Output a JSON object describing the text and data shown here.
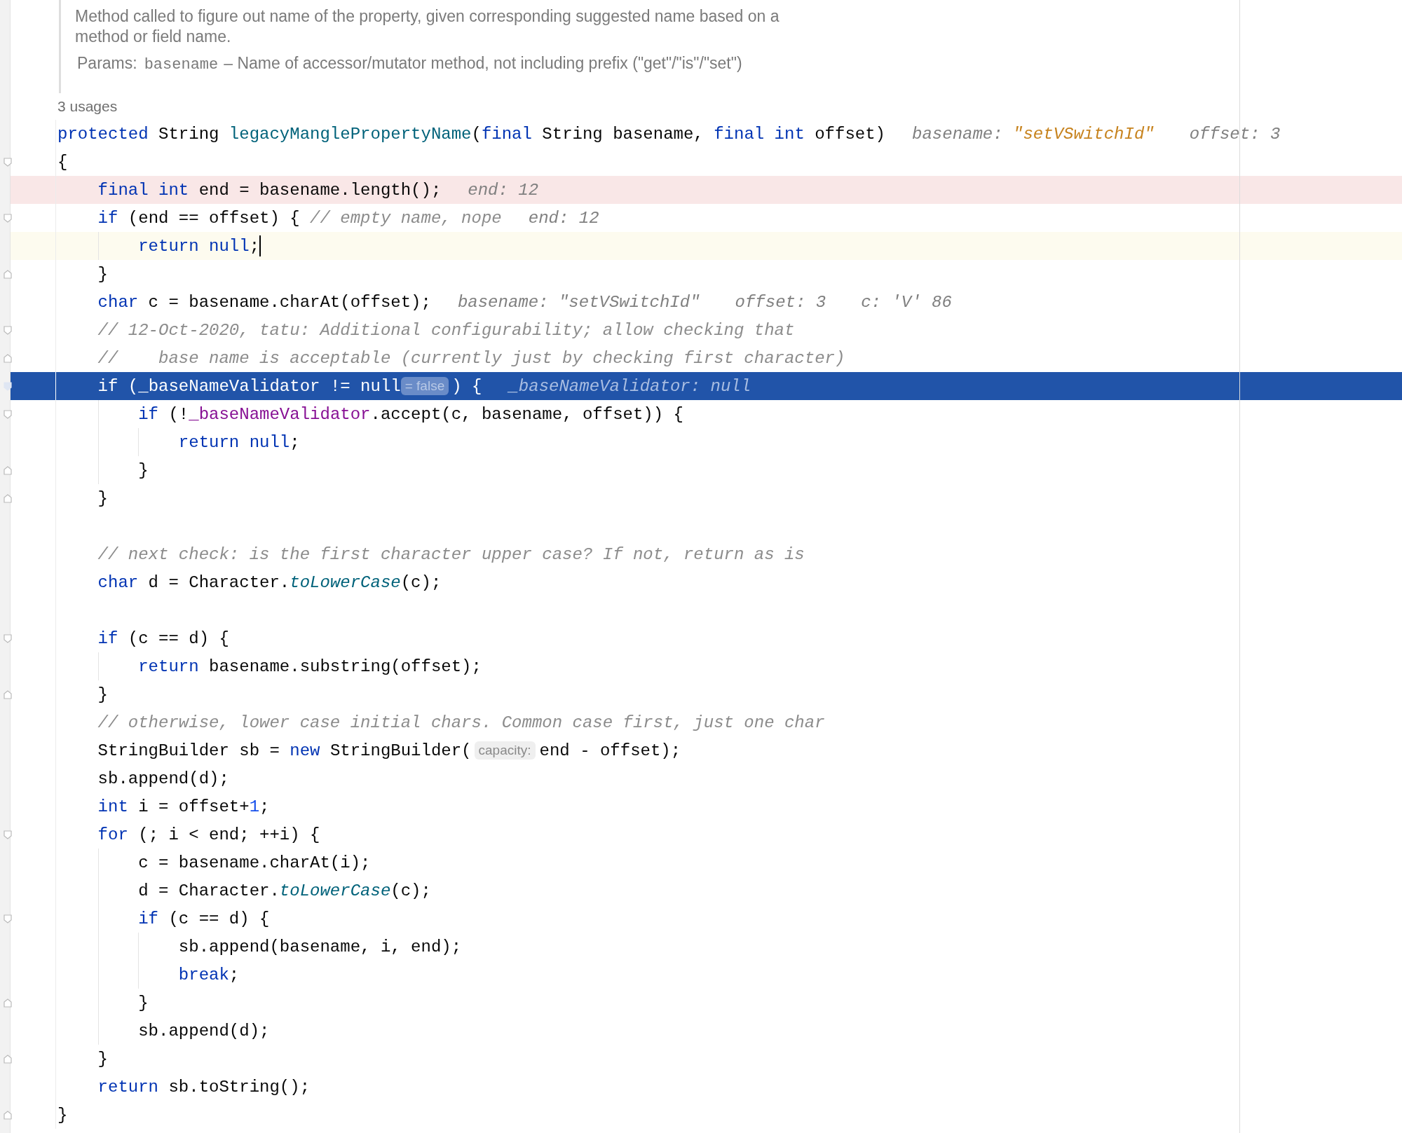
{
  "doc": {
    "description": "Method called to figure out name of the property, given corresponding suggested name based on a method or field name.",
    "params": {
      "label": "Params:",
      "name": "basename",
      "description": "– Name of accessor/mutator method, not including prefix (\"get\"/\"is\"/\"set\")"
    }
  },
  "usages": "3 usages",
  "lines": [
    {
      "kind": "plain",
      "fold_start": false,
      "fold_end": false,
      "parts": [
        {
          "kind": "code",
          "tokens": [
            {
              "kind": "kw",
              "text": "protected"
            },
            {
              "kind": "plain",
              "text": " String "
            },
            {
              "kind": "decl",
              "text": "legacyManglePropertyName"
            },
            {
              "kind": "plain",
              "text": "("
            },
            {
              "kind": "kw",
              "text": "final"
            },
            {
              "kind": "plain",
              "text": " String basename, "
            },
            {
              "kind": "kw",
              "text": "final int"
            },
            {
              "kind": "plain",
              "text": " offset)"
            }
          ]
        },
        {
          "kind": "hint",
          "label": "basename: ",
          "value": "\"setVSwitchId\"",
          "changed": true
        },
        {
          "kind": "hint",
          "label": "offset: ",
          "value": "3",
          "changed": false
        }
      ]
    },
    {
      "kind": "plain",
      "fold_start": true,
      "fold_end": false,
      "parts": [
        {
          "kind": "code",
          "tokens": [
            {
              "kind": "plain",
              "text": "{"
            }
          ]
        }
      ]
    },
    {
      "kind": "error",
      "fold_start": false,
      "fold_end": false,
      "parts": [
        {
          "kind": "code",
          "tokens": [
            {
              "kind": "kw",
              "text": "    final int"
            },
            {
              "kind": "plain",
              "text": " end = basename.length();"
            }
          ]
        },
        {
          "kind": "hint",
          "label": "end: ",
          "value": "12",
          "changed": false
        }
      ]
    },
    {
      "kind": "plain",
      "fold_start": true,
      "fold_end": false,
      "parts": [
        {
          "kind": "code",
          "tokens": [
            {
              "kind": "kw",
              "text": "    if"
            },
            {
              "kind": "plain",
              "text": " (end == offset) { "
            },
            {
              "kind": "comment",
              "text": "// empty name, nope"
            }
          ]
        },
        {
          "kind": "hint",
          "label": "end: ",
          "value": "12",
          "changed": false
        }
      ]
    },
    {
      "kind": "caret",
      "fold_start": false,
      "fold_end": false,
      "parts": [
        {
          "kind": "code",
          "tokens": [
            {
              "kind": "kw",
              "text": "        return null"
            },
            {
              "kind": "plain",
              "text": ";"
            }
          ]
        }
      ]
    },
    {
      "kind": "plain",
      "fold_start": false,
      "fold_end": true,
      "parts": [
        {
          "kind": "code",
          "tokens": [
            {
              "kind": "plain",
              "text": "    }"
            }
          ]
        }
      ]
    },
    {
      "kind": "plain",
      "fold_start": false,
      "fold_end": false,
      "parts": [
        {
          "kind": "code",
          "tokens": [
            {
              "kind": "kw",
              "text": "    char"
            },
            {
              "kind": "plain",
              "text": " c = basename.charAt(offset);"
            }
          ]
        },
        {
          "kind": "hint",
          "label": "basename: ",
          "value": "\"setVSwitchId\"",
          "changed": false
        },
        {
          "kind": "hint",
          "label": "offset: ",
          "value": "3",
          "changed": false
        },
        {
          "kind": "hint",
          "label": "c: ",
          "value": "'V' 86",
          "changed": false
        }
      ]
    },
    {
      "kind": "plain",
      "fold_start": true,
      "fold_end": false,
      "parts": [
        {
          "kind": "code",
          "tokens": [
            {
              "kind": "comment",
              "text": "    // 12-Oct-2020, tatu: Additional configurability; allow checking that"
            }
          ]
        }
      ]
    },
    {
      "kind": "plain",
      "fold_start": false,
      "fold_end": true,
      "parts": [
        {
          "kind": "code",
          "tokens": [
            {
              "kind": "comment",
              "text": "    //    base name is acceptable (currently just by checking first character)"
            }
          ]
        }
      ]
    },
    {
      "kind": "execution",
      "fold_start": true,
      "fold_end": false,
      "parts": [
        {
          "kind": "code",
          "tokens": [
            {
              "kind": "kw",
              "text": "    if"
            },
            {
              "kind": "plain",
              "text": " ("
            },
            {
              "kind": "field",
              "text": "_baseNameValidator"
            },
            {
              "kind": "plain",
              "text": " != "
            },
            {
              "kind": "kw",
              "text": "null"
            }
          ]
        },
        {
          "kind": "inlay",
          "text": "= false"
        },
        {
          "kind": "code",
          "tokens": [
            {
              "kind": "plain",
              "text": ") {"
            }
          ]
        },
        {
          "kind": "hint",
          "label": "_baseNameValidator: ",
          "value": "null",
          "changed": false
        }
      ]
    },
    {
      "kind": "plain",
      "fold_start": true,
      "fold_end": false,
      "parts": [
        {
          "kind": "code",
          "tokens": [
            {
              "kind": "kw",
              "text": "        if"
            },
            {
              "kind": "plain",
              "text": " (!"
            },
            {
              "kind": "field",
              "text": "_baseNameValidator"
            },
            {
              "kind": "plain",
              "text": ".accept(c, basename, offset)) {"
            }
          ]
        }
      ]
    },
    {
      "kind": "plain",
      "fold_start": false,
      "fold_end": false,
      "parts": [
        {
          "kind": "code",
          "tokens": [
            {
              "kind": "kw",
              "text": "            return null"
            },
            {
              "kind": "plain",
              "text": ";"
            }
          ]
        }
      ]
    },
    {
      "kind": "plain",
      "fold_start": false,
      "fold_end": true,
      "parts": [
        {
          "kind": "code",
          "tokens": [
            {
              "kind": "plain",
              "text": "        }"
            }
          ]
        }
      ]
    },
    {
      "kind": "plain",
      "fold_start": false,
      "fold_end": true,
      "parts": [
        {
          "kind": "code",
          "tokens": [
            {
              "kind": "plain",
              "text": "    }"
            }
          ]
        }
      ]
    },
    {
      "kind": "plain",
      "fold_start": false,
      "fold_end": false
    },
    {
      "kind": "plain",
      "fold_start": false,
      "fold_end": false,
      "parts": [
        {
          "kind": "code",
          "tokens": [
            {
              "kind": "comment",
              "text": "    // next check: is the first character upper case? If not, return as is"
            }
          ]
        }
      ]
    },
    {
      "kind": "plain",
      "fold_start": false,
      "fold_end": false,
      "parts": [
        {
          "kind": "code",
          "tokens": [
            {
              "kind": "kw",
              "text": "    char"
            },
            {
              "kind": "plain",
              "text": " d = Character."
            },
            {
              "kind": "static",
              "text": "toLowerCase"
            },
            {
              "kind": "plain",
              "text": "(c);"
            }
          ]
        }
      ]
    },
    {
      "kind": "plain",
      "fold_start": false,
      "fold_end": false
    },
    {
      "kind": "plain",
      "fold_start": true,
      "fold_end": false,
      "parts": [
        {
          "kind": "code",
          "tokens": [
            {
              "kind": "kw",
              "text": "    if"
            },
            {
              "kind": "plain",
              "text": " (c == d) {"
            }
          ]
        }
      ]
    },
    {
      "kind": "plain",
      "fold_start": false,
      "fold_end": false,
      "parts": [
        {
          "kind": "code",
          "tokens": [
            {
              "kind": "kw",
              "text": "        return"
            },
            {
              "kind": "plain",
              "text": " basename.substring(offset);"
            }
          ]
        }
      ]
    },
    {
      "kind": "plain",
      "fold_start": false,
      "fold_end": true,
      "parts": [
        {
          "kind": "code",
          "tokens": [
            {
              "kind": "plain",
              "text": "    }"
            }
          ]
        }
      ]
    },
    {
      "kind": "plain",
      "fold_start": false,
      "fold_end": false,
      "parts": [
        {
          "kind": "code",
          "tokens": [
            {
              "kind": "comment",
              "text": "    // otherwise, lower case initial chars. Common case first, just one char"
            }
          ]
        }
      ]
    },
    {
      "kind": "plain",
      "fold_start": false,
      "fold_end": false,
      "parts": [
        {
          "kind": "code",
          "tokens": [
            {
              "kind": "plain",
              "text": "    StringBuilder sb = "
            },
            {
              "kind": "kw",
              "text": "new"
            },
            {
              "kind": "plain",
              "text": " StringBuilder("
            }
          ]
        },
        {
          "kind": "inlay",
          "text": "capacity:"
        },
        {
          "kind": "code",
          "tokens": [
            {
              "kind": "plain",
              "text": "end - offset);"
            }
          ]
        }
      ]
    },
    {
      "kind": "plain",
      "fold_start": false,
      "fold_end": false,
      "parts": [
        {
          "kind": "code",
          "tokens": [
            {
              "kind": "plain",
              "text": "    sb.append(d);"
            }
          ]
        }
      ]
    },
    {
      "kind": "plain",
      "fold_start": false,
      "fold_end": false,
      "parts": [
        {
          "kind": "code",
          "tokens": [
            {
              "kind": "kw",
              "text": "    int"
            },
            {
              "kind": "plain",
              "text": " i = offset+"
            },
            {
              "kind": "num",
              "text": "1"
            },
            {
              "kind": "plain",
              "text": ";"
            }
          ]
        }
      ]
    },
    {
      "kind": "plain",
      "fold_start": true,
      "fold_end": false,
      "parts": [
        {
          "kind": "code",
          "tokens": [
            {
              "kind": "kw",
              "text": "    for"
            },
            {
              "kind": "plain",
              "text": " (; i < end; ++i) {"
            }
          ]
        }
      ]
    },
    {
      "kind": "plain",
      "fold_start": false,
      "fold_end": false,
      "parts": [
        {
          "kind": "code",
          "tokens": [
            {
              "kind": "plain",
              "text": "        c = basename.charAt(i);"
            }
          ]
        }
      ]
    },
    {
      "kind": "plain",
      "fold_start": false,
      "fold_end": false,
      "parts": [
        {
          "kind": "code",
          "tokens": [
            {
              "kind": "plain",
              "text": "        d = Character."
            },
            {
              "kind": "static",
              "text": "toLowerCase"
            },
            {
              "kind": "plain",
              "text": "(c);"
            }
          ]
        }
      ]
    },
    {
      "kind": "plain",
      "fold_start": true,
      "fold_end": false,
      "parts": [
        {
          "kind": "code",
          "tokens": [
            {
              "kind": "kw",
              "text": "        if"
            },
            {
              "kind": "plain",
              "text": " (c == d) {"
            }
          ]
        }
      ]
    },
    {
      "kind": "plain",
      "fold_start": false,
      "fold_end": false,
      "parts": [
        {
          "kind": "code",
          "tokens": [
            {
              "kind": "plain",
              "text": "            sb.append(basename, i, end);"
            }
          ]
        }
      ]
    },
    {
      "kind": "plain",
      "fold_start": false,
      "fold_end": false,
      "parts": [
        {
          "kind": "code",
          "tokens": [
            {
              "kind": "kw",
              "text": "            break"
            },
            {
              "kind": "plain",
              "text": ";"
            }
          ]
        }
      ]
    },
    {
      "kind": "plain",
      "fold_start": false,
      "fold_end": true,
      "parts": [
        {
          "kind": "code",
          "tokens": [
            {
              "kind": "plain",
              "text": "        }"
            }
          ]
        }
      ]
    },
    {
      "kind": "plain",
      "fold_start": false,
      "fold_end": false,
      "parts": [
        {
          "kind": "code",
          "tokens": [
            {
              "kind": "plain",
              "text": "        sb.append(d);"
            }
          ]
        }
      ]
    },
    {
      "kind": "plain",
      "fold_start": false,
      "fold_end": true,
      "parts": [
        {
          "kind": "code",
          "tokens": [
            {
              "kind": "plain",
              "text": "    }"
            }
          ]
        }
      ]
    },
    {
      "kind": "plain",
      "fold_start": false,
      "fold_end": false,
      "parts": [
        {
          "kind": "code",
          "tokens": [
            {
              "kind": "kw",
              "text": "    return"
            },
            {
              "kind": "plain",
              "text": " sb.toString();"
            }
          ]
        }
      ]
    },
    {
      "kind": "plain",
      "fold_start": false,
      "fold_end": true,
      "parts": [
        {
          "kind": "code",
          "tokens": [
            {
              "kind": "plain",
              "text": "}"
            }
          ]
        }
      ]
    }
  ]
}
